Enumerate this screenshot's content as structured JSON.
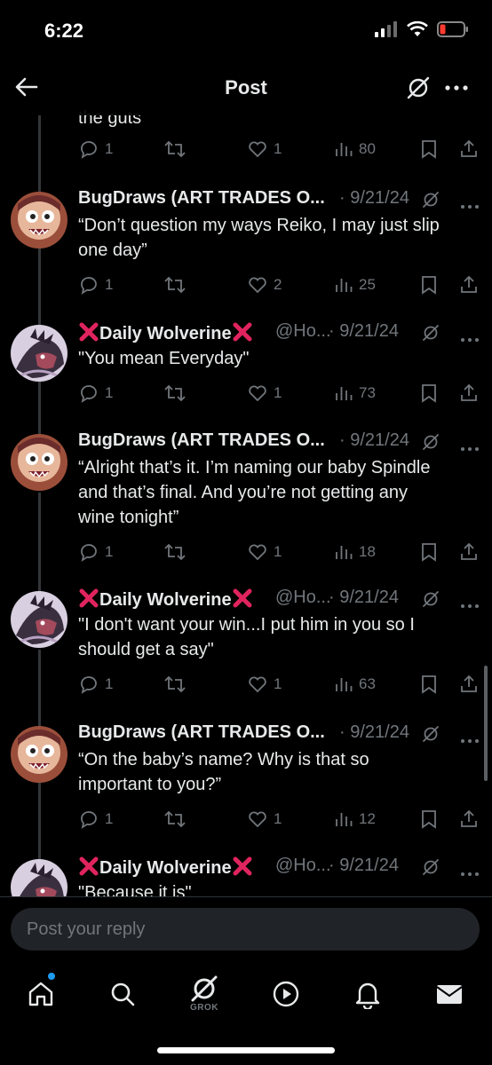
{
  "status_bar": {
    "time": "6:22"
  },
  "header": {
    "title": "Post"
  },
  "thread": {
    "partial_text": "the guts",
    "first_actions": {
      "replies": "1",
      "likes": "1",
      "views": "80"
    },
    "tweets": [
      {
        "author": "BugDraws (ART TRADES O...",
        "handle": "",
        "date": "· 9/21/24",
        "lines": [
          "“Don’t question my ways Reiko, I may just slip",
          "one day”"
        ],
        "replies": "1",
        "likes": "2",
        "views": "25",
        "avatar": "bugdraws"
      },
      {
        "author": "Daily Wolverine",
        "handle": "@Ho...",
        "date": "· 9/21/24",
        "lines": [
          "\"You mean Everyday\""
        ],
        "replies": "1",
        "likes": "1",
        "views": "73",
        "avatar": "wolverine"
      },
      {
        "author": "BugDraws (ART TRADES O...",
        "handle": "",
        "date": "· 9/21/24",
        "lines": [
          "“Alright that’s it. I’m naming our baby Spindle",
          "and that’s final. And you’re not getting any",
          "wine tonight”"
        ],
        "replies": "1",
        "likes": "1",
        "views": "18",
        "avatar": "bugdraws"
      },
      {
        "author": "Daily Wolverine",
        "handle": "@Ho...",
        "date": "· 9/21/24",
        "lines": [
          "\"I don't want your win...I put him in you so I",
          "should get a say\""
        ],
        "replies": "1",
        "likes": "1",
        "views": "63",
        "avatar": "wolverine"
      },
      {
        "author": "BugDraws (ART TRADES O...",
        "handle": "",
        "date": "· 9/21/24",
        "lines": [
          "“On the baby’s name? Why is that so",
          "important to you?”"
        ],
        "replies": "1",
        "likes": "1",
        "views": "12",
        "avatar": "bugdraws"
      },
      {
        "author": "Daily Wolverine",
        "handle": "@Ho...",
        "date": "· 9/21/24",
        "lines": [
          "\"Because it is\""
        ],
        "replies": "",
        "likes": "",
        "views": "",
        "avatar": "wolverine"
      }
    ]
  },
  "reply": {
    "placeholder": "Post your reply"
  },
  "bottom_nav": {
    "items": [
      "home-icon",
      "search-icon",
      "grok-icon",
      "video-icon",
      "notifications-icon",
      "messages-icon"
    ],
    "grok_label": "GROK"
  },
  "colors": {
    "background": "#000000",
    "text": "#e7e9ea",
    "muted": "#71767b",
    "accent": "#1d9bf0",
    "red_x": "#e0245e"
  }
}
